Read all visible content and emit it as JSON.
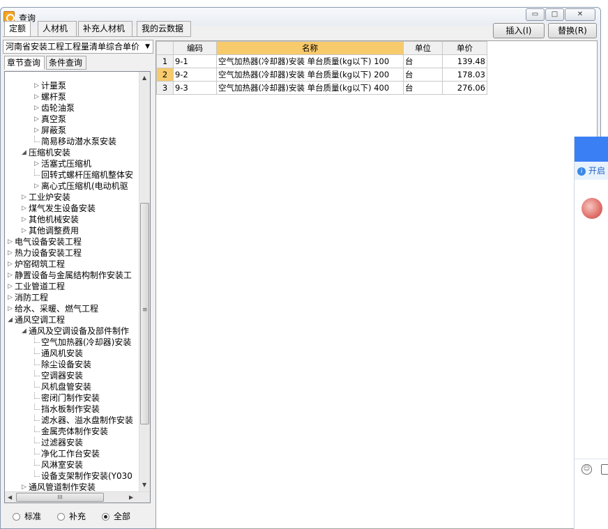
{
  "window": {
    "title": "查询",
    "controls": {
      "minimize": "▭",
      "maximize": "□",
      "close": "✕"
    }
  },
  "tabs": [
    "定额",
    "人材机",
    "补充人材机",
    "我的云数据"
  ],
  "actions": {
    "insert": "插入(I)",
    "replace": "替换(R)"
  },
  "library": {
    "selected": "河南省安装工程工程量清单综合单价"
  },
  "search_tabs": [
    "章节查询",
    "条件查询"
  ],
  "tree": [
    {
      "label": "计量泵",
      "arrow": "▷"
    },
    {
      "label": "螺杆泵",
      "arrow": "▷"
    },
    {
      "label": "齿轮油泵",
      "arrow": "▷"
    },
    {
      "label": "真空泵",
      "arrow": "▷"
    },
    {
      "label": "屏蔽泵",
      "arrow": "▷"
    },
    {
      "label": "简易移动潜水泵安装",
      "arrow": ""
    },
    {
      "label": "压缩机安装",
      "arrow": "◢"
    },
    {
      "label": "活塞式压缩机",
      "arrow": "▷"
    },
    {
      "label": "回转式螺杆压缩机整体安",
      "arrow": ""
    },
    {
      "label": "离心式压缩机(电动机驱",
      "arrow": "▷"
    },
    {
      "label": "工业炉安装",
      "arrow": "▷"
    },
    {
      "label": "煤气发生设备安装",
      "arrow": "▷"
    },
    {
      "label": "其他机械安装",
      "arrow": "▷"
    },
    {
      "label": "其他调整费用",
      "arrow": "▷"
    },
    {
      "label": "电气设备安装工程",
      "arrow": "▷"
    },
    {
      "label": "热力设备安装工程",
      "arrow": "▷"
    },
    {
      "label": "炉窑砌筑工程",
      "arrow": "▷"
    },
    {
      "label": "静置设备与金属结构制作安装工",
      "arrow": "▷"
    },
    {
      "label": "工业管道工程",
      "arrow": "▷"
    },
    {
      "label": "消防工程",
      "arrow": "▷"
    },
    {
      "label": "给水、采暖、燃气工程",
      "arrow": "▷"
    },
    {
      "label": "通风空调工程",
      "arrow": "◢"
    },
    {
      "label": "通风及空调设备及部件制作",
      "arrow": "◢"
    },
    {
      "label": "空气加热器(冷却器)安装",
      "arrow": ""
    },
    {
      "label": "通风机安装",
      "arrow": ""
    },
    {
      "label": "除尘设备安装",
      "arrow": ""
    },
    {
      "label": "空调器安装",
      "arrow": ""
    },
    {
      "label": "风机盘管安装",
      "arrow": ""
    },
    {
      "label": "密闭门制作安装",
      "arrow": ""
    },
    {
      "label": "挡水板制作安装",
      "arrow": ""
    },
    {
      "label": "滤水器、溢水盘制作安装",
      "arrow": ""
    },
    {
      "label": "金属壳体制作安装",
      "arrow": ""
    },
    {
      "label": "过滤器安装",
      "arrow": ""
    },
    {
      "label": "净化工作台安装",
      "arrow": ""
    },
    {
      "label": "风淋室安装",
      "arrow": ""
    },
    {
      "label": "设备支架制作安装(Y030",
      "arrow": ""
    },
    {
      "label": "通风管道制作安装",
      "arrow": "▷"
    }
  ],
  "scroll": {
    "grip": "≡",
    "hgrip": "III",
    "up": "▲",
    "down": "▼",
    "left": "◀",
    "right": "▶"
  },
  "filters": [
    {
      "label": "标准",
      "checked": false
    },
    {
      "label": "补充",
      "checked": false
    },
    {
      "label": "全部",
      "checked": true
    }
  ],
  "grid": {
    "headers": [
      "编码",
      "名称",
      "单位",
      "单价"
    ],
    "rows": [
      {
        "n": "1",
        "code": "9-1",
        "name": "空气加热器(冷却器)安装 单台质量(kg以下) 100",
        "unit": "台",
        "price": "139.48"
      },
      {
        "n": "2",
        "code": "9-2",
        "name": "空气加热器(冷却器)安装 单台质量(kg以下) 200",
        "unit": "台",
        "price": "178.03"
      },
      {
        "n": "3",
        "code": "9-3",
        "name": "空气加热器(冷却器)安装 单台质量(kg以下) 400",
        "unit": "台",
        "price": "276.06"
      }
    ],
    "selected_row": 2
  },
  "side_panel": {
    "info_text": "开启",
    "info_icon": "i",
    "emoji": "☺"
  },
  "colors": {
    "selection": "#f7ca6b",
    "side_header": "#3b7ff5"
  }
}
